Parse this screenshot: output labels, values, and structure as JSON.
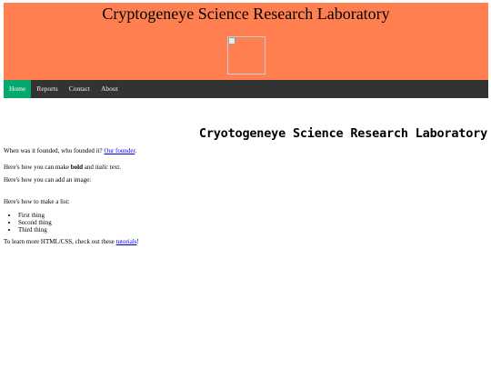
{
  "header": {
    "title": "Cryptogeneye Science Research Laboratory"
  },
  "nav": {
    "items": [
      {
        "label": "Home",
        "active": true
      },
      {
        "label": "Reports"
      },
      {
        "label": "Contact"
      },
      {
        "label": "About"
      }
    ]
  },
  "main": {
    "heading": "Cryotogeneye Science Research Laboratory",
    "founded_text": "When was it founded, who founded it?",
    "founder_link": "Our founder",
    "period": ".",
    "bold_intro": "Here's how you can make",
    "bold_word": "bold",
    "and_word": "and",
    "italic_word": "italic",
    "text_word": "text.",
    "image_text": "Here's how you can add an image:",
    "list_intro": "Here's how to make a list:",
    "list_items": [
      "First thing",
      "Second thing",
      "Third thing"
    ],
    "learn_text": "To learn more HTML/CSS, check out these",
    "tutorials_link": "tutorials",
    "exclaim": "!"
  },
  "colors": {
    "header_bg": "#ff7f50",
    "nav_bg": "#333333",
    "nav_active": "#04aa6d",
    "link": "#0000ee"
  }
}
